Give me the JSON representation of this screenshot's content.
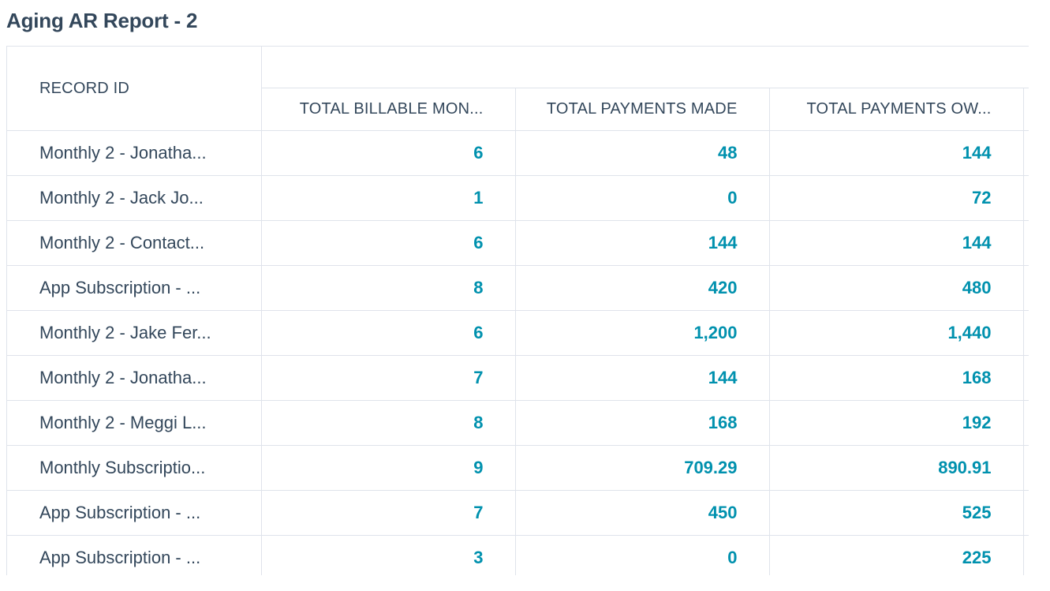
{
  "report": {
    "title": "Aging AR Report - 2"
  },
  "table": {
    "headers": {
      "record_id": "RECORD ID",
      "total_billable_months": "TOTAL BILLABLE MON...",
      "total_payments_made": "TOTAL PAYMENTS MADE",
      "total_payments_owed": "TOTAL PAYMENTS OW..."
    },
    "rows": [
      {
        "record": "Monthly 2 - Jonatha...",
        "billable": "6",
        "made": "48",
        "owed": "144"
      },
      {
        "record": "Monthly 2 - Jack Jo...",
        "billable": "1",
        "made": "0",
        "owed": "72"
      },
      {
        "record": "Monthly 2 - Contact...",
        "billable": "6",
        "made": "144",
        "owed": "144"
      },
      {
        "record": "App Subscription - ...",
        "billable": "8",
        "made": "420",
        "owed": "480"
      },
      {
        "record": "Monthly 2 - Jake Fer...",
        "billable": "6",
        "made": "1,200",
        "owed": "1,440"
      },
      {
        "record": "Monthly 2 - Jonatha...",
        "billable": "7",
        "made": "144",
        "owed": "168"
      },
      {
        "record": "Monthly 2 - Meggi L...",
        "billable": "8",
        "made": "168",
        "owed": "192"
      },
      {
        "record": "Monthly Subscriptio...",
        "billable": "9",
        "made": "709.29",
        "owed": "890.91"
      },
      {
        "record": "App Subscription - ...",
        "billable": "7",
        "made": "450",
        "owed": "525"
      },
      {
        "record": "App Subscription - ...",
        "billable": "3",
        "made": "0",
        "owed": "225"
      }
    ]
  },
  "colors": {
    "heading_text": "#33475b",
    "value_link": "#0091ae",
    "grid_line": "#dfe3eb",
    "background": "#ffffff"
  }
}
